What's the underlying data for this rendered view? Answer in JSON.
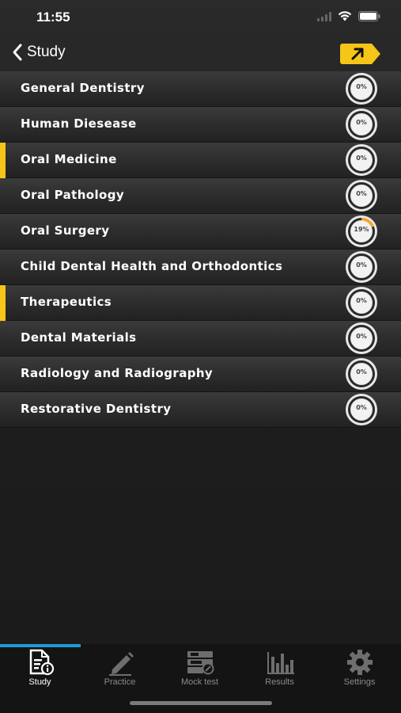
{
  "status_bar": {
    "time": "11:55"
  },
  "nav": {
    "back_label": "Study"
  },
  "subjects": [
    {
      "label": "General Dentistry",
      "progress_text": "0%",
      "progress": 0,
      "flagged": false
    },
    {
      "label": "Human Diesease",
      "progress_text": "0%",
      "progress": 0,
      "flagged": false
    },
    {
      "label": "Oral Medicine",
      "progress_text": "0%",
      "progress": 0,
      "flagged": true
    },
    {
      "label": "Oral Pathology",
      "progress_text": "0%",
      "progress": 0,
      "flagged": false
    },
    {
      "label": "Oral Surgery",
      "progress_text": "19%",
      "progress": 19,
      "flagged": false
    },
    {
      "label": "Child Dental Health and Orthodontics",
      "progress_text": "0%",
      "progress": 0,
      "flagged": false
    },
    {
      "label": "Therapeutics",
      "progress_text": "0%",
      "progress": 0,
      "flagged": true
    },
    {
      "label": "Dental Materials",
      "progress_text": "0%",
      "progress": 0,
      "flagged": false
    },
    {
      "label": "Radiology and Radiography",
      "progress_text": "0%",
      "progress": 0,
      "flagged": false
    },
    {
      "label": "Restorative Dentistry",
      "progress_text": "0%",
      "progress": 0,
      "flagged": false
    }
  ],
  "tabs": {
    "study": "Study",
    "practice": "Practice",
    "mock_test": "Mock test",
    "results": "Results",
    "settings": "Settings"
  },
  "active_tab": "study",
  "colors": {
    "accent": "#f5c518",
    "tab_indicator": "#1e9bd7",
    "progress_arc": "#f5a623"
  },
  "icons": {
    "back": "chevron-left-icon",
    "share": "share-arrow-icon",
    "signal": "signal-icon",
    "wifi": "wifi-icon",
    "battery": "battery-icon",
    "study": "study-document-icon",
    "practice": "pencil-icon",
    "mock_test": "mock-test-icon",
    "results": "bar-chart-icon",
    "settings": "gear-icon"
  }
}
